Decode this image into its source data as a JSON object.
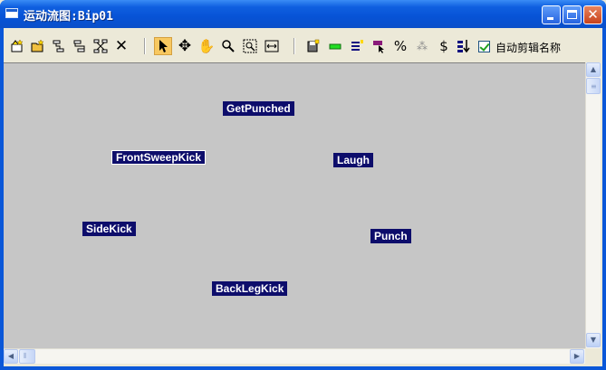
{
  "window": {
    "title": "运动流图:Bip01"
  },
  "toolbar": {
    "tools": [
      {
        "name": "create-clip-icon"
      },
      {
        "name": "open-clips-icon"
      },
      {
        "name": "transition-icon"
      },
      {
        "name": "random-transition-icon"
      },
      {
        "name": "optimize-transitions-icon"
      },
      {
        "name": "delete-icon"
      },
      {
        "name": "select-icon",
        "active": true
      },
      {
        "name": "move-icon"
      },
      {
        "name": "pan-hand-icon"
      },
      {
        "name": "zoom-icon"
      },
      {
        "name": "zoom-region-icon"
      },
      {
        "name": "zoom-extents-icon"
      },
      {
        "name": "save-script-icon"
      },
      {
        "name": "green-bar-icon"
      },
      {
        "name": "edit-list-icon"
      },
      {
        "name": "define-start-icon"
      },
      {
        "name": "percent-icon"
      },
      {
        "name": "random-icon"
      },
      {
        "name": "dollar-icon"
      },
      {
        "name": "show-list-icon"
      }
    ],
    "auto_clip_name_label": "自动剪辑名称",
    "auto_clip_name_checked": true
  },
  "graph": {
    "nodes": [
      {
        "label": "GetPunched",
        "selected": false
      },
      {
        "label": "FrontSweepKick",
        "selected": true
      },
      {
        "label": "Laugh",
        "selected": false
      },
      {
        "label": "SideKick",
        "selected": false
      },
      {
        "label": "Punch",
        "selected": false
      },
      {
        "label": "BackLegKick",
        "selected": false
      }
    ]
  },
  "colors": {
    "node_bg": "#0d0d6b",
    "canvas_bg": "#c6c6c6",
    "titlebar": "#0753d6",
    "close_button": "#c8421b"
  }
}
